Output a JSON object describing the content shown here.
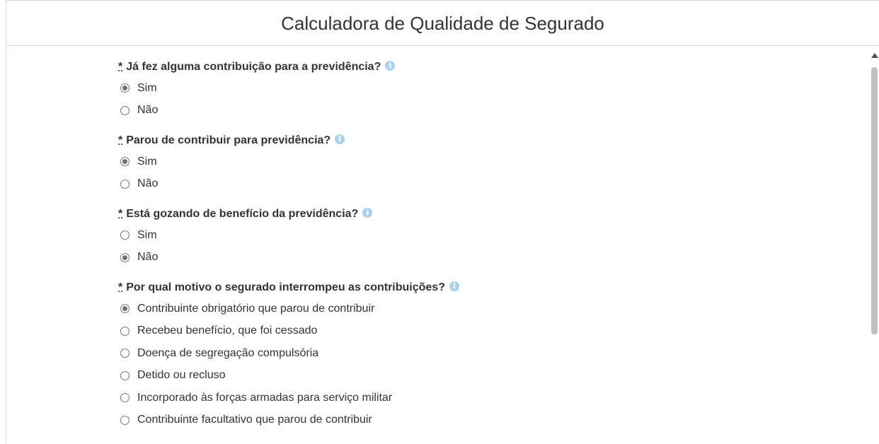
{
  "header": {
    "title": "Calculadora de Qualidade de Segurado"
  },
  "questions": [
    {
      "required_mark": "*",
      "label": "Já fez alguma contribuição para a previdência?",
      "options": [
        {
          "label": "Sim",
          "checked": true
        },
        {
          "label": "Não",
          "checked": false
        }
      ]
    },
    {
      "required_mark": "*",
      "label": "Parou de contribuir para previdência?",
      "options": [
        {
          "label": "Sim",
          "checked": true
        },
        {
          "label": "Não",
          "checked": false
        }
      ]
    },
    {
      "required_mark": "*",
      "label": "Está gozando de benefício da previdência?",
      "options": [
        {
          "label": "Sim",
          "checked": false
        },
        {
          "label": "Não",
          "checked": true
        }
      ]
    },
    {
      "required_mark": "*",
      "label": "Por qual motivo o segurado interrompeu as contribuições?",
      "options": [
        {
          "label": "Contribuinte obrigatório que parou de contribuir",
          "checked": true
        },
        {
          "label": "Recebeu benefício, que foi cessado",
          "checked": false
        },
        {
          "label": "Doença de segregação compulsória",
          "checked": false
        },
        {
          "label": "Detido ou recluso",
          "checked": false
        },
        {
          "label": "Incorporado às forças armadas para serviço militar",
          "checked": false
        },
        {
          "label": "Contribuinte facultativo que parou de contribuir",
          "checked": false
        }
      ]
    }
  ],
  "icons": {
    "info": "info-icon",
    "info_glyph": "i"
  },
  "colors": {
    "info_icon": "#a8d3ea",
    "text": "#333333",
    "border": "#d9d9d9"
  }
}
